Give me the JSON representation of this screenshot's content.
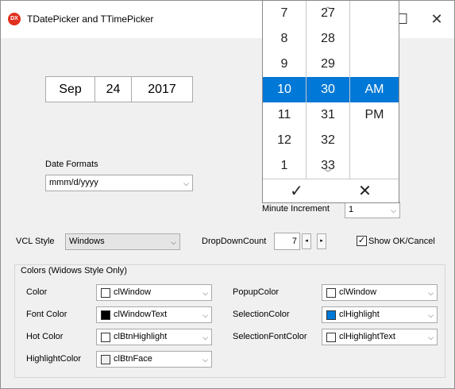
{
  "window": {
    "title": "TDatePicker and TTimePicker",
    "icon_text": "DX",
    "maximize_glyph": "☐",
    "close_glyph": "✕"
  },
  "date": {
    "month": "Sep",
    "day": "24",
    "year": "2017"
  },
  "date_formats": {
    "label": "Date Formats",
    "value": "mmm/d/yyyy"
  },
  "minute_increment": {
    "label": "Minute Increment",
    "value": "1"
  },
  "vcl_style": {
    "label": "VCL Style",
    "value": "Windows"
  },
  "dropdown_count": {
    "label": "DropDownCount",
    "value": "7",
    "dec": "◂",
    "inc": "▸"
  },
  "show_ok_cancel": {
    "label": "Show OK/Cancel",
    "checked": true,
    "mark": "✓"
  },
  "colors_group": {
    "title": "Colors (Widows Style Only)",
    "left": [
      {
        "label": "Color",
        "value": "clWindow",
        "swatch": "#ffffff"
      },
      {
        "label": "Font Color",
        "value": "clWindowText",
        "swatch": "#000000"
      },
      {
        "label": "Hot Color",
        "value": "clBtnHighlight",
        "swatch": "#ffffff"
      },
      {
        "label": "HighlightColor",
        "value": "clBtnFace",
        "swatch": "#f0f0f0"
      }
    ],
    "right": [
      {
        "label": "PopupColor",
        "value": "clWindow",
        "swatch": "#ffffff"
      },
      {
        "label": "SelectionColor",
        "value": "clHighlight",
        "swatch": "#0078d7"
      },
      {
        "label": "SelectionFontColor",
        "value": "clHighlightText",
        "swatch": "#ffffff"
      }
    ]
  },
  "time_picker": {
    "hours": [
      "7",
      "8",
      "9",
      "10",
      "11",
      "12",
      "1"
    ],
    "minutes": [
      "27",
      "28",
      "29",
      "30",
      "31",
      "32",
      "33"
    ],
    "ampm": [
      "AM",
      "PM"
    ],
    "selected_hour": "10",
    "selected_minute": "30",
    "selected_ampm": "AM",
    "ok_glyph": "✓",
    "cancel_glyph": "✕",
    "scroll_up_glyph": "︿",
    "scroll_down_glyph": "﹀"
  },
  "dropdown_arrow": "⌵",
  "colors": {
    "selection": "#0078d7"
  }
}
